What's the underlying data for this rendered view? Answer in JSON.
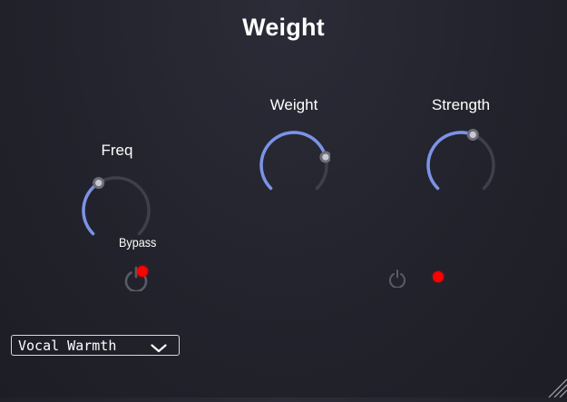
{
  "plugin": {
    "title": "Weight"
  },
  "knobs": [
    {
      "id": "freq",
      "label": "Freq",
      "value": 0.38
    },
    {
      "id": "weight",
      "label": "Weight",
      "value": 0.78
    },
    {
      "id": "strength",
      "label": "Strength",
      "value": 0.58
    }
  ],
  "bypass": {
    "label": "Bypass"
  },
  "preset": {
    "selected": "Vocal Warmth"
  },
  "colors": {
    "background": "#23232d",
    "knob_track": "#3e3f4a",
    "knob_value_arc": "#7b93e8",
    "knob_pointer": "#c8c8d0",
    "led": "#ff0000",
    "power_icon": "#5a5b66",
    "text": "#ffffff"
  },
  "icons": {
    "power": "power-icon",
    "dropdown": "chevron-down-icon",
    "resize": "resize-grip-icon"
  }
}
